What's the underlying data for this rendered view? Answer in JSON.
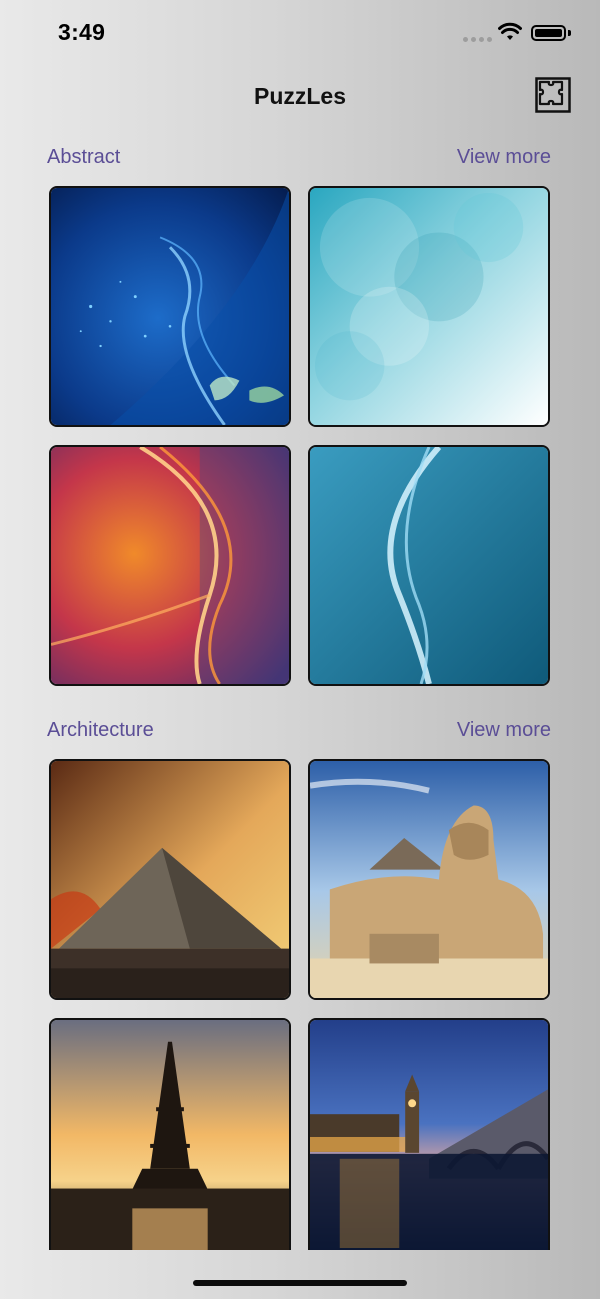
{
  "status_bar": {
    "time": "3:49"
  },
  "nav": {
    "title": "PuzzLes",
    "action_icon": "puzzle-icon"
  },
  "sections": [
    {
      "title": "Abstract",
      "view_more": "View more",
      "tiles": [
        "abstract-blue-smoke",
        "abstract-teal-bokeh",
        "abstract-orange-waves",
        "abstract-blue-swirl"
      ]
    },
    {
      "title": "Architecture",
      "view_more": "View more",
      "tiles": [
        "pyramid-sunset",
        "sphinx",
        "eiffel-tower",
        "big-ben"
      ]
    }
  ],
  "colors": {
    "accent": "#5b4e96",
    "text": "#111111"
  }
}
